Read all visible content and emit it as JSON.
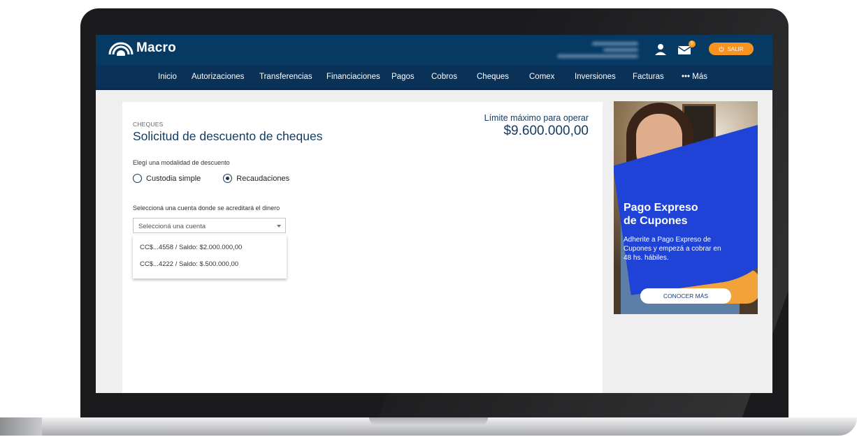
{
  "brand": {
    "name": "Macro"
  },
  "header": {
    "badge_count": "5",
    "logout_label": "SALIR",
    "icons": [
      "user-icon",
      "mail-icon",
      "power-icon"
    ]
  },
  "nav": {
    "items": [
      "Inicio",
      "Autorizaciones",
      "Transferencias",
      "Financiaciones",
      "Pagos",
      "Cobros",
      "Cheques",
      "Comex",
      "Inversiones",
      "Facturas",
      "••• Más"
    ]
  },
  "main": {
    "breadcrumb": "CHEQUES",
    "title": "Solicitud de descuento de cheques",
    "limit_label": "Límite máximo para operar",
    "limit_value": "$9.600.000,00",
    "modality_label": "Elegí una modalidad de descuento",
    "options": [
      {
        "label": "Custodia simple",
        "selected": false
      },
      {
        "label": "Recaudaciones",
        "selected": true
      }
    ],
    "account_label": "Seleccioná una cuenta donde se acreditará el dinero",
    "account_placeholder": "Seleccioná una cuenta",
    "accounts": [
      "CC$...4558 / Saldo: $2.000.000,00",
      "CC$...4222  / Saldo: $.500.000,00"
    ]
  },
  "ad": {
    "title_line1": "Pago Expreso",
    "title_line2": "de Cupones",
    "text": "Adherite a Pago Expreso de Cupones y empezá a cobrar en 48 hs. hábiles.",
    "button": "CONOCER MÁS"
  },
  "colors": {
    "header_bg": "#063a63",
    "nav_bg": "#0a3157",
    "accent_orange": "#f7931e",
    "ad_blue": "#1f43d6",
    "text_navy": "#123a5f"
  }
}
